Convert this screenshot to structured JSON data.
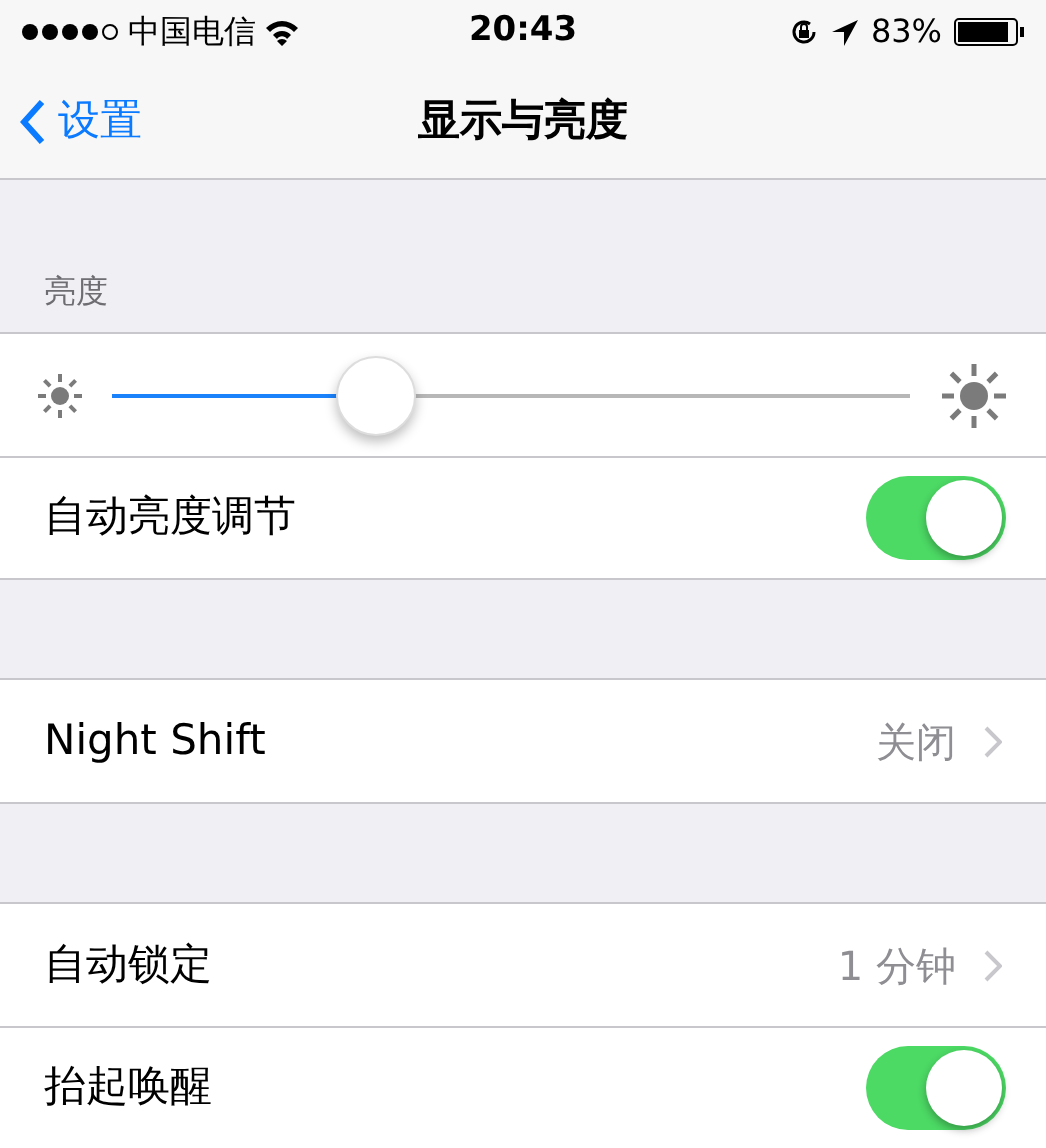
{
  "status_bar": {
    "carrier": "中国电信",
    "time": "20:43",
    "battery": "83%"
  },
  "nav": {
    "back": "设置",
    "title": "显示与亮度"
  },
  "sections": [
    {
      "header": "亮度",
      "rows": [
        {
          "kind": "slider",
          "level": 0.33
        },
        {
          "kind": "toggle",
          "label": "自动亮度调节",
          "on": true
        }
      ]
    },
    {
      "rows": [
        {
          "kind": "detail",
          "label": "Night Shift",
          "value": "关闭"
        }
      ]
    },
    {
      "rows": [
        {
          "kind": "detail",
          "label": "自动锁定",
          "value": "1 分钟"
        },
        {
          "kind": "toggle",
          "label": "抬起唤醒",
          "on": true
        }
      ]
    }
  ]
}
